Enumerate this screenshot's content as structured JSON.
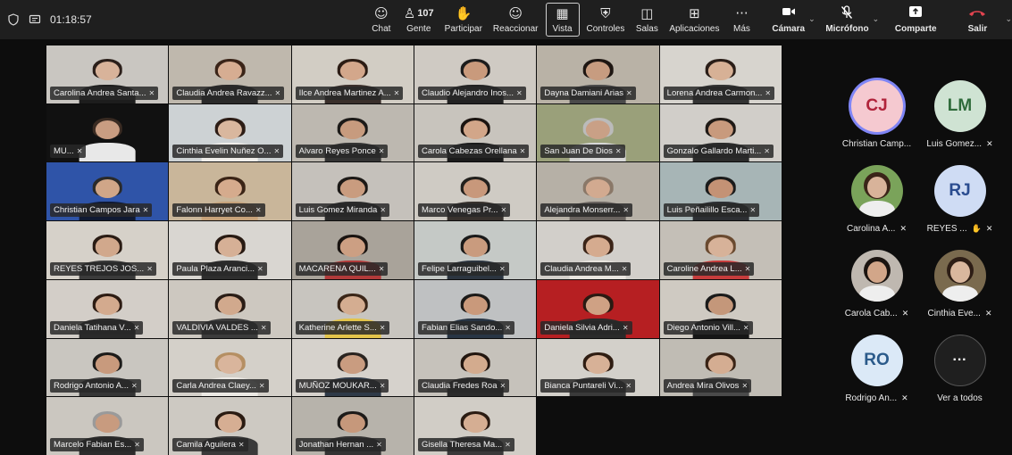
{
  "topbar": {
    "timer": "01:18:57",
    "tools": [
      {
        "id": "chat",
        "label": "Chat",
        "icon": "chat-icon",
        "glyph": "☺"
      },
      {
        "id": "people",
        "label": "Gente",
        "icon": "people-icon",
        "glyph": "♙",
        "count": "107"
      },
      {
        "id": "raise",
        "label": "Participar",
        "icon": "raise-hand-icon",
        "glyph": "✋"
      },
      {
        "id": "react",
        "label": "Reaccionar",
        "icon": "reaction-icon",
        "glyph": "☺"
      },
      {
        "id": "view",
        "label": "Vista",
        "icon": "view-grid-icon",
        "glyph": "▦",
        "active": true
      },
      {
        "id": "controls",
        "label": "Controles",
        "icon": "controls-icon",
        "glyph": "⛨"
      },
      {
        "id": "rooms",
        "label": "Salas",
        "icon": "rooms-icon",
        "glyph": "◫"
      },
      {
        "id": "apps",
        "label": "Aplicaciones",
        "icon": "apps-icon",
        "glyph": "⊞"
      },
      {
        "id": "more",
        "label": "Más",
        "icon": "more-icon",
        "glyph": "···"
      }
    ],
    "camera_label": "Cámara",
    "mic_label": "Micrófono",
    "share_label": "Comparte",
    "leave_label": "Salir"
  },
  "grid_tiles": [
    {
      "name": "Carolina Andrea Santa...",
      "bg": "#c9c6c1",
      "skin": "#d8b39a",
      "hair": "#2b1f1a",
      "shirt": "#1d1d1d"
    },
    {
      "name": "Claudia Andrea Ravazz...",
      "bg": "#bfb8ad",
      "skin": "#d6ad92",
      "hair": "#3a2418",
      "shirt": "#2a2a2a"
    },
    {
      "name": "Ilce Andrea Martinez A...",
      "bg": "#d2cdc4",
      "skin": "#d3a78b",
      "hair": "#2c1c14",
      "shirt": "#3a2f2b"
    },
    {
      "name": "Claudio Alejandro Inos...",
      "bg": "#cfcac3",
      "skin": "#c99a7c",
      "hair": "#1c1c1c",
      "shirt": "#222222"
    },
    {
      "name": "Dayna Damiani Arias",
      "bg": "#b9b2a6",
      "skin": "#c79c80",
      "hair": "#1e1612",
      "shirt": "#4a4a4a"
    },
    {
      "name": "Lorena Andrea Carmon...",
      "bg": "#d7d4ce",
      "skin": "#d7b196",
      "hair": "#2a1e18",
      "shirt": "#333333"
    },
    {
      "name": "MU...",
      "bg": "#111111",
      "skin": "#c99d82",
      "hair": "#3a2b22",
      "shirt": "#e8e8e8"
    },
    {
      "name": "Cinthia Evelin Nuñez O...",
      "bg": "#cdd2d4",
      "skin": "#d9b79e",
      "hair": "#2d1d15",
      "shirt": "#f0eeea"
    },
    {
      "name": "Alvaro Reyes Ponce",
      "bg": "#bdb8b0",
      "skin": "#c79b7e",
      "hair": "#1c1a18",
      "shirt": "#333333"
    },
    {
      "name": "Carola Cabezas Orellana",
      "bg": "#c8c4bd",
      "skin": "#d2a689",
      "hair": "#1b1410",
      "shirt": "#1b1b1b"
    },
    {
      "name": "San Juan De Dios",
      "bg": "#9aa07a",
      "skin": "#c9a086",
      "hair": "#bbbbbb",
      "shirt": "#d8d8d8"
    },
    {
      "name": "Gonzalo Gallardo Marti...",
      "bg": "#d1cec9",
      "skin": "#c89a7d",
      "hair": "#1f1a16",
      "shirt": "#2b2b2b"
    },
    {
      "name": "Christian Campos Jara",
      "bg": "#2f54a8",
      "skin": "#d0a688",
      "hair": "#2a2a2a",
      "shirt": "#101a33"
    },
    {
      "name": "Falonn Harryet Co...",
      "bg": "#c9b69a",
      "skin": "#d5ab8d",
      "hair": "#3a2416",
      "shirt": "#c7a27a"
    },
    {
      "name": "Luis Gomez Miranda",
      "bg": "#c5c1bb",
      "skin": "#c99c7f",
      "hair": "#1c1916",
      "shirt": "#2c2c2c"
    },
    {
      "name": "Marco Venegas Pr...",
      "bg": "#cfcbc4",
      "skin": "#c8987b",
      "hair": "#22201d",
      "shirt": "#38322e"
    },
    {
      "name": "Alejandra Monserr...",
      "bg": "#b6b0a6",
      "skin": "#d2aa90",
      "hair": "#8a7868",
      "shirt": "#6a6460"
    },
    {
      "name": "Luis Peñailillo Esca...",
      "bg": "#a7b5b6",
      "skin": "#c49275",
      "hair": "#1b1b1b",
      "shirt": "#2d2f33"
    },
    {
      "name": "REYES TREJOS JOS...",
      "bg": "#d6d1c9",
      "skin": "#d1a88c",
      "hair": "#2a1c14",
      "shirt": "#3b3b3b"
    },
    {
      "name": "Paula Plaza Aranci...",
      "bg": "#d9d6d1",
      "skin": "#d6b096",
      "hair": "#281a12",
      "shirt": "#2e2e2e"
    },
    {
      "name": "MACARENA QUIL...",
      "bg": "#a9a39a",
      "skin": "#cc9f83",
      "hair": "#1a1411",
      "shirt": "#b23a3a"
    },
    {
      "name": "Felipe Larraguibel...",
      "bg": "#c5c9c6",
      "skin": "#c99b7e",
      "hair": "#1a1a1a",
      "shirt": "#2c3540"
    },
    {
      "name": "Claudia Andrea M...",
      "bg": "#d2cfca",
      "skin": "#d5ab8f",
      "hair": "#3b2417",
      "shirt": "#e9e5df"
    },
    {
      "name": "Caroline Andrea L...",
      "bg": "#c4bfb7",
      "skin": "#d7b299",
      "hair": "#6a4a30",
      "shirt": "#c73c3c"
    },
    {
      "name": "Daniela Tatihana V...",
      "bg": "#d3cec8",
      "skin": "#d3aa8e",
      "hair": "#2d1c13",
      "shirt": "#2a2a2a"
    },
    {
      "name": "VALDIVIA VALDES ...",
      "bg": "#cdc8c0",
      "skin": "#d1a98d",
      "hair": "#2a1d16",
      "shirt": "#3c3c3c"
    },
    {
      "name": "Katherine Arlette S...",
      "bg": "#c8c5bf",
      "skin": "#d4ad91",
      "hair": "#3a2618",
      "shirt": "#e3c44a"
    },
    {
      "name": "Fabian Elias Sando...",
      "bg": "#bfc1c2",
      "skin": "#c9997b",
      "hair": "#1c1a18",
      "shirt": "#283544"
    },
    {
      "name": "Daniela Silvia Adri...",
      "bg": "#b61f22",
      "skin": "#cfa184",
      "hair": "#2a1a12",
      "shirt": "#2b2b2b"
    },
    {
      "name": "Diego Antonio Vill...",
      "bg": "#cfcac2",
      "skin": "#c4977a",
      "hair": "#1a1a1a",
      "shirt": "#161616"
    },
    {
      "name": "Rodrigo Antonio A...",
      "bg": "#c9c6c0",
      "skin": "#c89a7d",
      "hair": "#1c1b19",
      "shirt": "#353535"
    },
    {
      "name": "Carla Andrea Claey...",
      "bg": "#d4d0c9",
      "skin": "#d9b59c",
      "hair": "#b58f63",
      "shirt": "#ece9e4"
    },
    {
      "name": "MUÑOZ MOUKAR...",
      "bg": "#d6d2cc",
      "skin": "#c99c80",
      "hair": "#2a2420",
      "shirt": "#2f3a48"
    },
    {
      "name": "Claudia Fredes Roa",
      "bg": "#c6c2bb",
      "skin": "#d3ab8e",
      "hair": "#22160f",
      "shirt": "#2b2b2b"
    },
    {
      "name": "Bianca Puntareli Vi...",
      "bg": "#d3d0ca",
      "skin": "#d7b197",
      "hair": "#2f1d12",
      "shirt": "#3a3a3a"
    },
    {
      "name": "Andrea Mira Olivos",
      "bg": "#c0bcb4",
      "skin": "#d4ad92",
      "hair": "#3a2416",
      "shirt": "#4a4a4a"
    },
    {
      "name": "Marcelo Fabian Es...",
      "bg": "#cbc7c0",
      "skin": "#c89b7f",
      "hair": "#9a9a9a",
      "shirt": "#2c2c2c"
    },
    {
      "name": "Camila Aguilera",
      "bg": "#cdc9c2",
      "skin": "#d6ae93",
      "hair": "#2a1b12",
      "shirt": "#3a3a3a"
    },
    {
      "name": "Jonathan Hernan ...",
      "bg": "#b7b3ab",
      "skin": "#c6987b",
      "hair": "#1d1b19",
      "shirt": "#333333"
    },
    {
      "name": "Gisella Theresa Ma...",
      "bg": "#d1cdc6",
      "skin": "#d5ae93",
      "hair": "#2b1c13",
      "shirt": "#3a3a3a"
    }
  ],
  "sidebar": {
    "participants": [
      {
        "initials": "CJ",
        "name": "Christian Camp...",
        "avatar_bg": "#f5c9d0",
        "avatar_fg": "#b0233a",
        "ring": true,
        "muted": false
      },
      {
        "initials": "LM",
        "name": "Luis Gomez...",
        "avatar_bg": "#cfe3d3",
        "avatar_fg": "#2f6b3b",
        "muted": true
      },
      {
        "initials": "",
        "name": "Carolina A...",
        "photo_bg": "#7aa35a",
        "skin": "#d8b39a",
        "hair": "#3a2418",
        "muted": true
      },
      {
        "initials": "RJ",
        "name": "REYES ...",
        "avatar_bg": "#cfdcf4",
        "avatar_fg": "#2a4c8f",
        "muted": true,
        "extra_icon": "hand-icon"
      },
      {
        "initials": "",
        "name": "Carola Cab...",
        "photo_bg": "#bfb8b0",
        "skin": "#d2a689",
        "hair": "#1b1410",
        "muted": true
      },
      {
        "initials": "",
        "name": "Cinthia Eve...",
        "photo_bg": "#7a6a4e",
        "skin": "#d9b79e",
        "hair": "#2d1d15",
        "muted": true
      },
      {
        "initials": "RO",
        "name": "Rodrigo An...",
        "avatar_bg": "#dbe9f7",
        "avatar_fg": "#2a5a8a",
        "muted": true
      },
      {
        "initials": "···",
        "name": "Ver a todos",
        "more": true,
        "muted": false
      }
    ]
  }
}
